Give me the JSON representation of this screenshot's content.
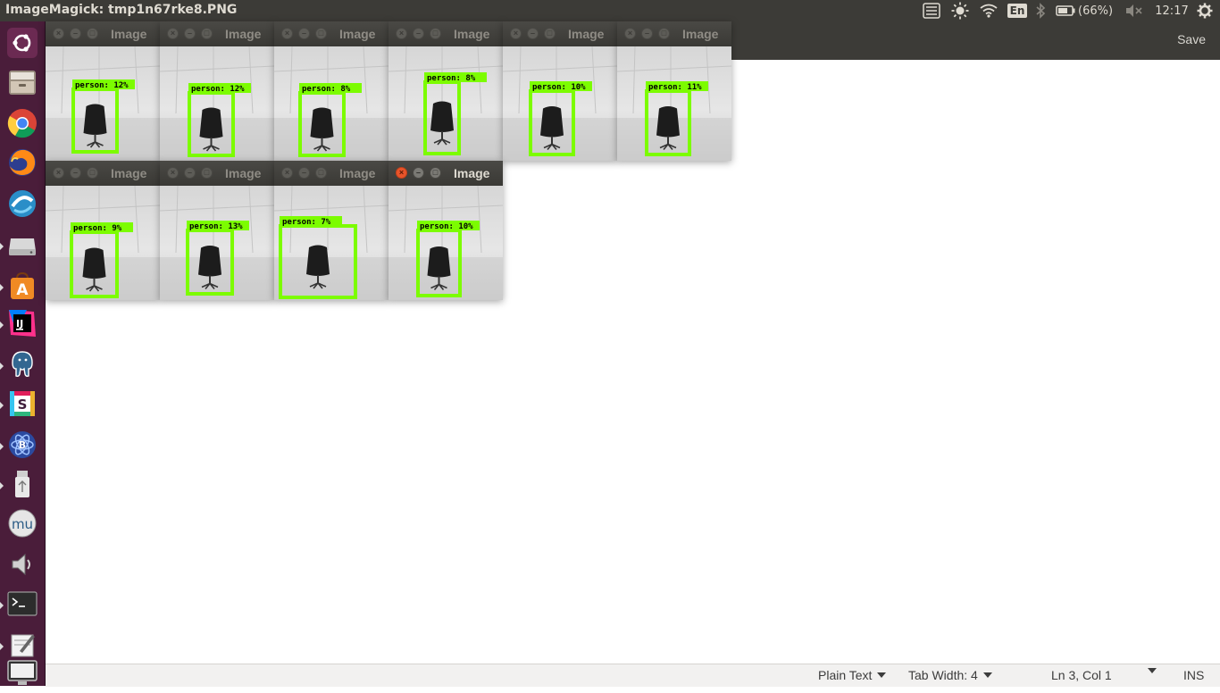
{
  "top_panel": {
    "title": "ImageMagick: tmp1n67rke8.PNG",
    "keyboard_layout": "En",
    "battery": "(66%)",
    "clock": "12:17"
  },
  "gedit": {
    "save_label": "Save",
    "status": {
      "language": "Plain Text",
      "tab_width": "Tab Width: 4",
      "position": "Ln 3, Col 1",
      "mode": "INS"
    }
  },
  "colors": {
    "panel": "#3c3b37",
    "launcher": "#4a1d3a",
    "detection_box": "#7cfc00",
    "close_active": "#e8542a"
  },
  "launcher_items": [
    {
      "name": "ubuntu-dash-icon"
    },
    {
      "name": "files-icon"
    },
    {
      "name": "chrome-icon"
    },
    {
      "name": "firefox-icon"
    },
    {
      "name": "network-app-icon"
    },
    {
      "name": "drive-icon"
    },
    {
      "name": "software-center-icon"
    },
    {
      "name": "intellij-icon"
    },
    {
      "name": "postgres-icon"
    },
    {
      "name": "slack-icon"
    },
    {
      "name": "atom-icon"
    },
    {
      "name": "usb-drive-icon"
    },
    {
      "name": "mu-editor-icon"
    },
    {
      "name": "sound-icon"
    },
    {
      "name": "terminal-icon"
    },
    {
      "name": "text-editor-icon"
    },
    {
      "name": "display-icon"
    }
  ],
  "windows": [
    {
      "title": "Image",
      "label": "person: 12%",
      "active": false
    },
    {
      "title": "Image",
      "label": "person: 12%",
      "active": false
    },
    {
      "title": "Image",
      "label": "person: 8%",
      "active": false
    },
    {
      "title": "Image",
      "label": "person: 8%",
      "active": false
    },
    {
      "title": "Image",
      "label": "person: 10%",
      "active": false
    },
    {
      "title": "Image",
      "label": "person: 11%",
      "active": false
    },
    {
      "title": "Image",
      "label": "person: 9%",
      "active": false
    },
    {
      "title": "Image",
      "label": "person: 13%",
      "active": false
    },
    {
      "title": "Image",
      "label": "person: 7%",
      "active": false
    },
    {
      "title": "Image",
      "label": "person: 10%",
      "active": true
    }
  ]
}
